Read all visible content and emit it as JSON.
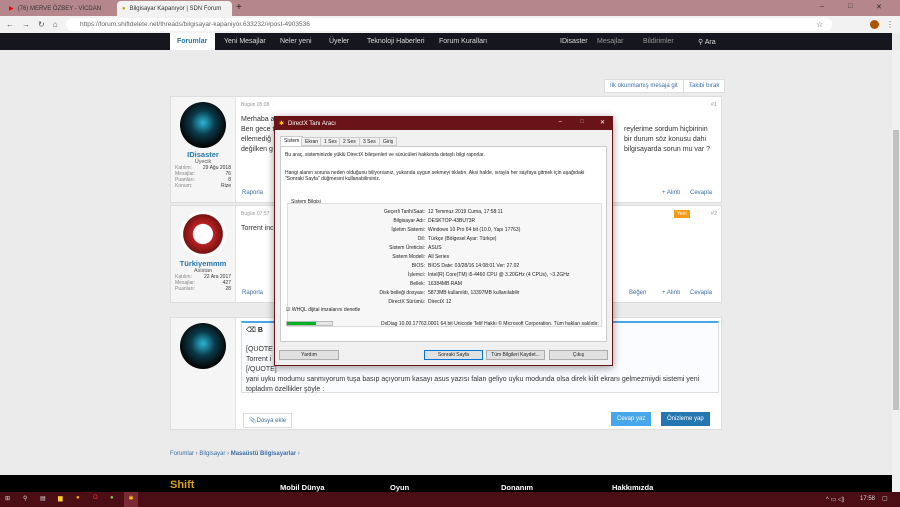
{
  "browser": {
    "tabs": [
      {
        "title": "(76) MERVE ÖZBEY - VİCDAN",
        "icon": "youtube-icon"
      },
      {
        "title": "Bilgisayar Kapanıyor | SDN Forum",
        "icon": "sdn-icon"
      }
    ],
    "new_tab": "+",
    "url": "https://forum.shiftdelete.net/threads/bilgisayar-kapaniyor.633232/#post-4903536",
    "minimize": "–",
    "maximize": "□",
    "close": "✕"
  },
  "nav": {
    "items": [
      "Forumlar",
      "Yeni Mesajlar",
      "Neler yeni",
      "Üyeler",
      "Teknoloji Haberleri",
      "Forum Kuralları"
    ],
    "user": "IDisaster",
    "messages": "Mesajlar",
    "alerts": "Bildirimler",
    "search": "Ara"
  },
  "thread_actions": {
    "unread": "İlk okunmamış mesaja git",
    "unwatch": "Takibi bırak"
  },
  "posts": [
    {
      "user": "IDisaster",
      "role": "Üyecik",
      "stats": [
        [
          "Katılım:",
          "29 Ağu 2018"
        ],
        [
          "Mesajlar:",
          "76"
        ],
        [
          "Puanları:",
          "8"
        ],
        [
          "Konum:",
          "Rize"
        ]
      ],
      "date": "Bugün 05:08",
      "num": "#1",
      "lines": [
        "Merhaba a",
        "Ben gece t",
        "ellemediğ",
        "değilken g"
      ],
      "lines_right": [
        "reylerime sordum hiçbirinin",
        "bir durum söz konusu dahi",
        "bilgisayarda sorun mu var ?"
      ],
      "report": "Raporla",
      "quote": "+ Alıntı",
      "reply": "Cevapla"
    },
    {
      "user": "Türkiyemmm",
      "role": "Asistan",
      "stats": [
        [
          "Katılım:",
          "22 Ara 2017"
        ],
        [
          "Mesajlar:",
          "427"
        ],
        [
          "Puanları:",
          "28"
        ]
      ],
      "date": "Bugün 07:57",
      "num": "#2",
      "badge": "Yeni",
      "lines": [
        "Torrent inc"
      ],
      "report": "Raporla",
      "like": "Beğen",
      "quote": "+ Alıntı",
      "reply": "Cevapla"
    }
  ],
  "editor": {
    "lines": [
      "[QUOTE",
      "Torrent i",
      "[/QUOTE]",
      "yani uyku modumu sanmıyorum tuşa basıp açıyorum kasayı asus yazısı falan geliyo uyku modunda olsa direk kilit ekranı gelmezmiydi sistemi yeni",
      "topladım özellikler şöyle :"
    ],
    "attach": "Dosya ekle",
    "submit": "Cevap yaz",
    "preview": "Önizleme yap"
  },
  "breadcrumb": [
    "Forumlar",
    "Bilgisayar",
    "Masaüstü Bilgisayarlar"
  ],
  "footer": {
    "logo": "Shift",
    "cols": [
      "Mobil Dünya",
      "Oyun",
      "Donanım",
      "Hakkımızda"
    ]
  },
  "dialog": {
    "title": "DirectX Tanı Aracı",
    "tabs": [
      "Sistem",
      "Ekran",
      "1 Ses",
      "2 Ses",
      "3 Ses",
      "Giriş"
    ],
    "intro": "Bu araç, sisteminizde yüklü DirectX bileşenleri ve sürücüleri hakkında detaylı bilgi raporlar.",
    "hint1": "Hangi alanın soruna neden olduğunu biliyorsanız, yukarıda uygun sekmeyi tıklatın. Aksi halde, sırayla her sayfaya gitmek için aşağıdaki",
    "hint2": "\"Sonraki Sayfa\" düğmesini kullanabilirsiniz.",
    "group": "Sistem Bilgisi",
    "info": [
      [
        "Geçerli Tarih/Saat:",
        "12 Temmuz 2019 Cuma, 17:58:11"
      ],
      [
        "Bilgisayar Adı:",
        "DESKTOP-43BU73R"
      ],
      [
        "İşletim Sistemi:",
        "Windows 10 Pro 64 bit (10.0, Yapı 17763)"
      ],
      [
        "Dil:",
        "Türkçe (Bölgesel Ayar: Türkçe)"
      ],
      [
        "Sistem Üreticisi:",
        "ASUS"
      ],
      [
        "Sistem Modeli:",
        "All Series"
      ],
      [
        "BIOS:",
        "BIOS Date: 03/28/16 14:08:01 Ver: 27.02"
      ],
      [
        "İşlemci:",
        "Intel(R) Core(TM) i5-4460  CPU @ 3.20GHz (4 CPUs), ~3.2GHz"
      ],
      [
        "Bellek:",
        "16384MB RAM"
      ],
      [
        "Disk belleği dosyası:",
        "5873MB kullanıldı, 13397MB kullanılabilir"
      ],
      [
        "DirectX Sürümü:",
        "DirectX 12"
      ]
    ],
    "whql": "WHQL dijital imzalarını denetle",
    "progress": 0.65,
    "copyright": "DxDiag 10.00.17763.0001 64 bit Unicode  Telif Hakkı © Microsoft Corporation. Tüm hakları saklıdır.",
    "buttons": [
      "Yardım",
      "Sonraki Sayfa",
      "Tüm Bilgileri Kaydet...",
      "Çıkış"
    ]
  },
  "taskbar": {
    "time": "17:58"
  }
}
